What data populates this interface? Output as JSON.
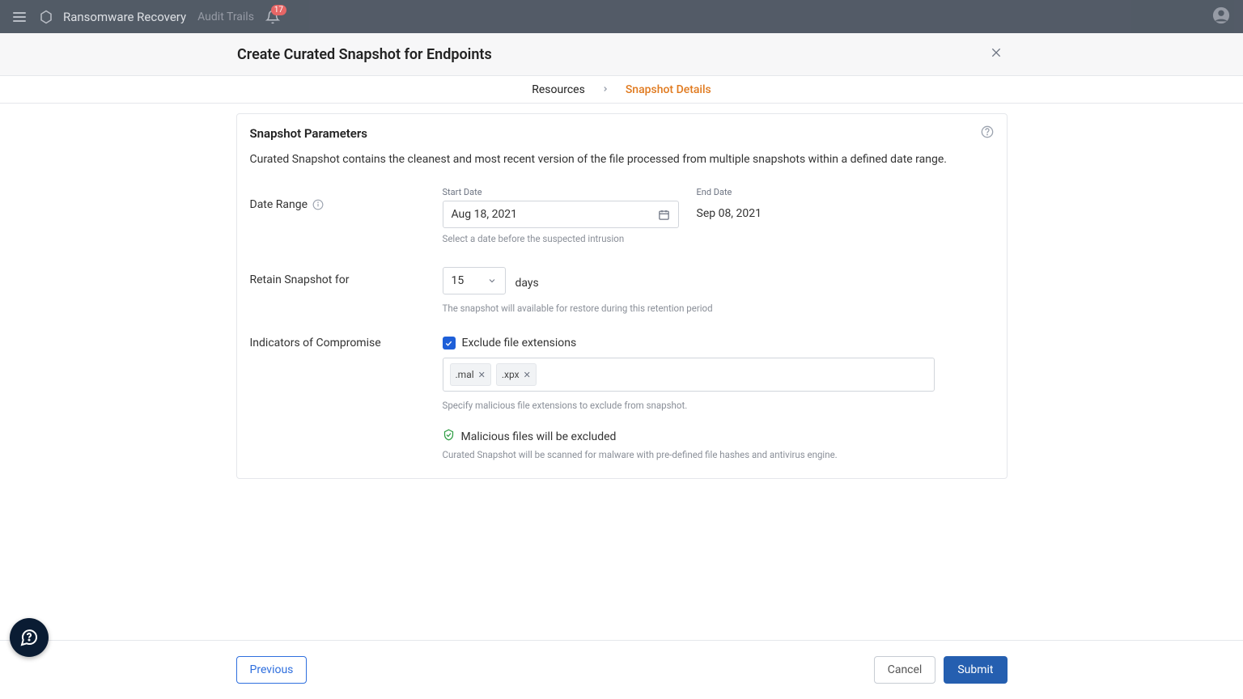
{
  "topbar": {
    "app_title": "Ransomware Recovery",
    "subtitle": "Audit Trails",
    "notification_count": "17"
  },
  "subheader": {
    "title": "Create Curated Snapshot for Endpoints"
  },
  "steps": {
    "step1": "Resources",
    "step2": "Snapshot Details"
  },
  "card": {
    "title": "Snapshot Parameters",
    "description": "Curated Snapshot contains the cleanest and most recent version of the file processed from multiple snapshots within a defined date range."
  },
  "date_range": {
    "label": "Date Range",
    "start_label": "Start Date",
    "start_value": "Aug 18, 2021",
    "start_helper": "Select a date before the suspected intrusion",
    "end_label": "End Date",
    "end_value": "Sep 08, 2021"
  },
  "retention": {
    "label": "Retain Snapshot for",
    "value": "15",
    "unit": "days",
    "helper": "The snapshot will available for restore during this retention period"
  },
  "ioc": {
    "label": "Indicators of Compromise",
    "checkbox_label": "Exclude file extensions",
    "tags": [
      ".mal",
      ".xpx"
    ],
    "helper": "Specify malicious file extensions to exclude from snapshot.",
    "shield_text": "Malicious files will be excluded",
    "shield_helper": "Curated Snapshot will be scanned for malware with pre-defined file hashes and antivirus engine."
  },
  "footer": {
    "previous": "Previous",
    "cancel": "Cancel",
    "submit": "Submit"
  }
}
